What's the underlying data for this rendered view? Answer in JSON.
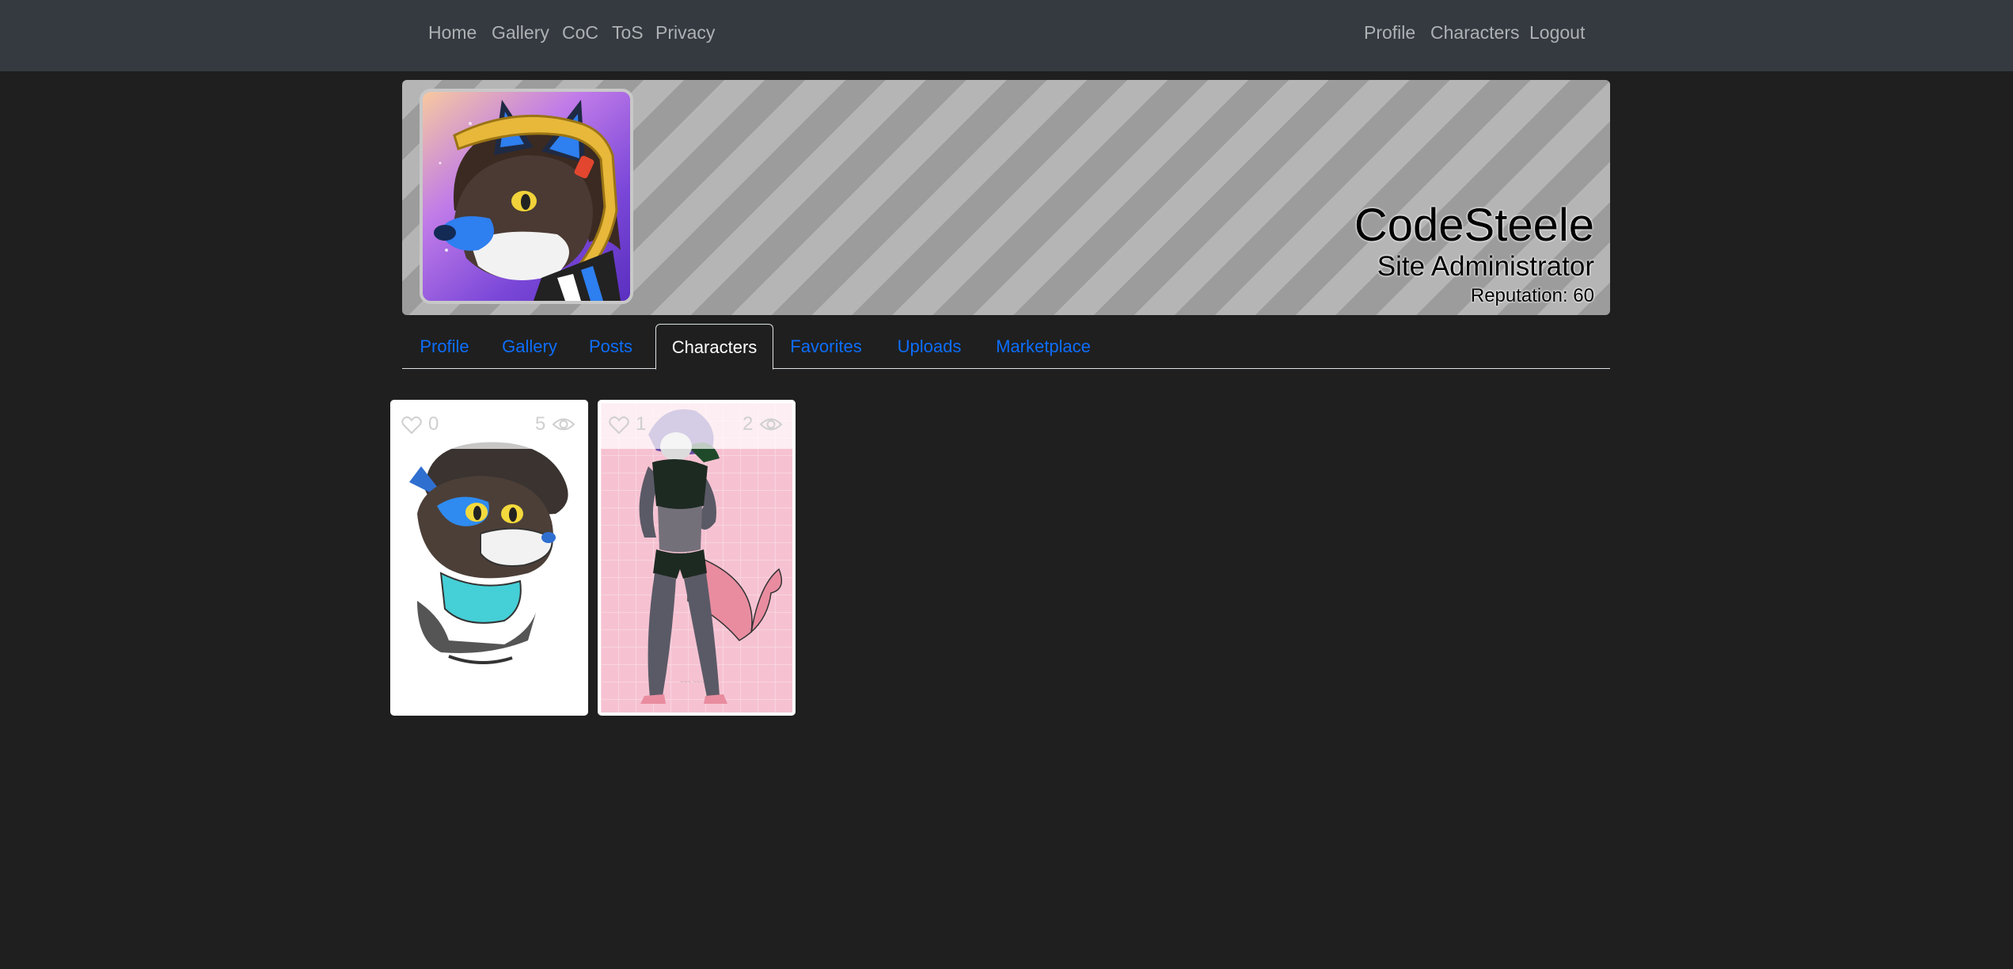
{
  "nav": {
    "left": [
      {
        "label": "Home"
      },
      {
        "label": "Gallery"
      },
      {
        "label": "CoC"
      },
      {
        "label": "ToS"
      },
      {
        "label": "Privacy"
      }
    ],
    "right": [
      {
        "label": "Profile"
      },
      {
        "label": "Characters"
      },
      {
        "label": "Logout"
      }
    ]
  },
  "profile": {
    "name": "CodeSteele",
    "role": "Site Administrator",
    "reputation": "Reputation: 60"
  },
  "tabs": [
    {
      "label": "Profile"
    },
    {
      "label": "Gallery"
    },
    {
      "label": "Posts"
    },
    {
      "label": "Characters"
    },
    {
      "label": "Favorites"
    },
    {
      "label": "Uploads"
    },
    {
      "label": "Marketplace"
    }
  ],
  "active_tab": "Characters",
  "cards": [
    {
      "likes": "0",
      "views": "5",
      "icon_like": "heart-icon",
      "icon_view": "eye-icon"
    },
    {
      "likes": "1",
      "views": "2",
      "icon_like": "heart-icon",
      "icon_view": "eye-icon"
    }
  ],
  "colors": {
    "navbar": "#343a40",
    "background": "#1f1f1f",
    "link": "#0d6efd",
    "nav_text": "#aeb1b4"
  }
}
